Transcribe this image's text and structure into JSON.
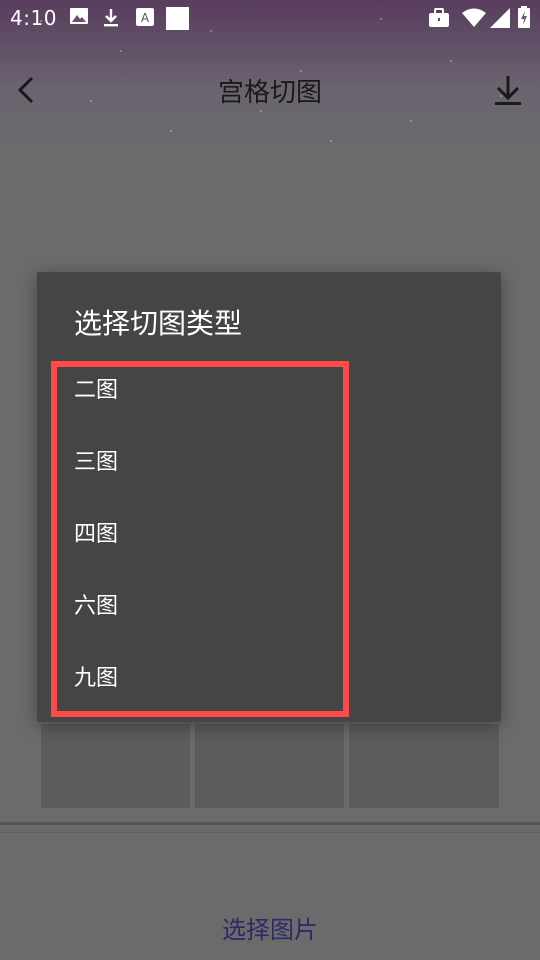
{
  "status_bar": {
    "time": "4:10",
    "icons": [
      "gallery-icon",
      "download-icon",
      "font-icon",
      "blank-notification-icon",
      "briefcase-icon",
      "wifi-icon",
      "signal-icon",
      "battery-charging-icon"
    ]
  },
  "toolbar": {
    "title": "宫格切图",
    "back_icon": "chevron-left-icon",
    "download_icon": "download-icon"
  },
  "dialog": {
    "title": "选择切图类型",
    "options": [
      {
        "label": "二图"
      },
      {
        "label": "三图"
      },
      {
        "label": "四图"
      },
      {
        "label": "六图"
      },
      {
        "label": "九图"
      }
    ]
  },
  "bottom": {
    "select_image_label": "选择图片"
  },
  "colors": {
    "dialog_bg": "#454545",
    "overlay_bg": "#6b6b6b",
    "highlight": "#ff4a4a",
    "accent_text": "#2d2a6a"
  }
}
